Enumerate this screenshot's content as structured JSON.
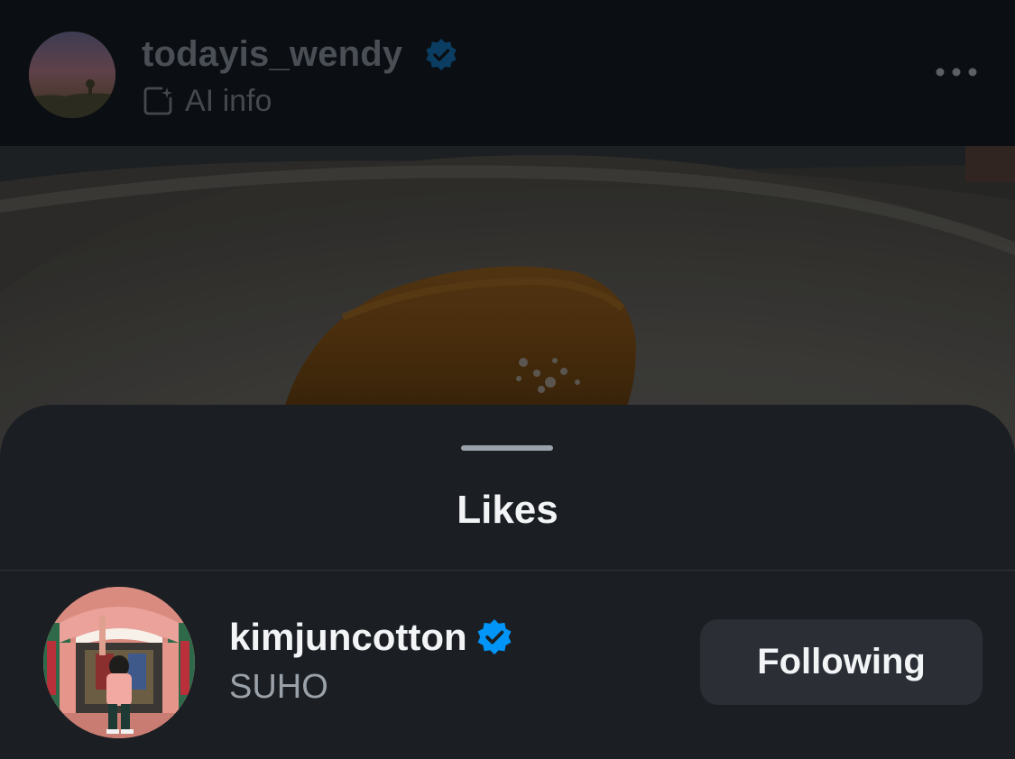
{
  "post": {
    "username": "todayis_wendy",
    "verified": true,
    "ai_label": "AI info",
    "icons": {
      "verified": "verified-badge-icon",
      "ai": "ai-info-icon",
      "more": "more-options-icon"
    }
  },
  "likes_sheet": {
    "title": "Likes",
    "items": [
      {
        "username": "kimjuncotton",
        "verified": true,
        "full_name": "SUHO",
        "button_label": "Following"
      }
    ]
  },
  "colors": {
    "verified_blue": "#0095f6",
    "sheet_background": "#1b1e22",
    "button_background": "#2b2f35"
  }
}
